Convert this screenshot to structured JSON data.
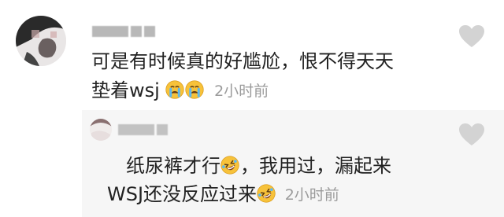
{
  "comment": {
    "username": "▇▇▇▇ ▇▇▇",
    "text_line1": "可是有时候真的好尴尬，恨不得天天",
    "text_line2": "垫着wsj",
    "emojis": [
      "crying-face",
      "crying-face"
    ],
    "time": "2小时前"
  },
  "reply": {
    "username": "▇▇▇▇ ▇▇",
    "text_line1_a": "纸尿裤才行",
    "text_line1_b": "，我用过，漏起来",
    "text_line2": "WSJ还没反应过来",
    "emojis": [
      "rolling-laughing-face",
      "rolling-laughing-face"
    ],
    "time": "2小时前"
  },
  "colors": {
    "text": "#222222",
    "muted": "#9b9b9b",
    "heart": "#d3d3d3",
    "reply_bg": "#f6f6f6"
  }
}
